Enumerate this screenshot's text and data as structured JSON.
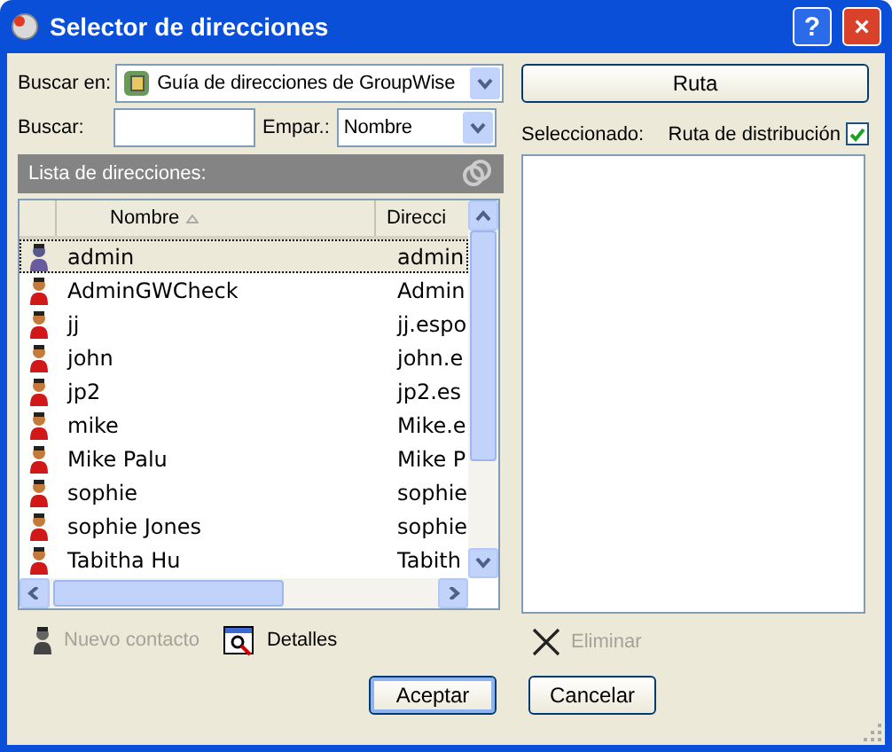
{
  "window": {
    "title": "Selector de direcciones",
    "help_button": "?",
    "close_button": "×"
  },
  "search_in": {
    "label": "Buscar en:",
    "value": "Guía de direcciones de GroupWise"
  },
  "search": {
    "label": "Buscar:"
  },
  "match": {
    "label": "Empar.:",
    "value": "Nombre"
  },
  "list": {
    "title": "Lista de direcciones:",
    "columns": [
      "Nombre",
      "Direcci"
    ],
    "rows": [
      {
        "name": "admin",
        "address": "admin",
        "selected": true
      },
      {
        "name": "AdminGWCheck",
        "address": "Admin",
        "selected": false
      },
      {
        "name": "jj",
        "address": "jj.espo",
        "selected": false
      },
      {
        "name": "john",
        "address": "john.e",
        "selected": false
      },
      {
        "name": "jp2",
        "address": "jp2.es",
        "selected": false
      },
      {
        "name": "mike",
        "address": "Mike.e",
        "selected": false
      },
      {
        "name": "Mike Palu",
        "address": "Mike P",
        "selected": false
      },
      {
        "name": "sophie",
        "address": "sophie",
        "selected": false
      },
      {
        "name": "sophie Jones",
        "address": "sophie",
        "selected": false
      },
      {
        "name": "Tabitha Hu",
        "address": "Tabith",
        "selected": false
      }
    ]
  },
  "left_actions": [
    {
      "label": "Nuevo contacto",
      "kind": "person",
      "disabled": true
    },
    {
      "label": "Detalles",
      "kind": "details",
      "disabled": false
    }
  ],
  "route_button": "Ruta",
  "selected_label": "Seleccionado:",
  "distribution_route": {
    "label": "Ruta de distribución",
    "checked": true
  },
  "remove_action": {
    "label": "Eliminar",
    "disabled": true
  },
  "buttons": [
    {
      "label": "Aceptar",
      "default": true
    },
    {
      "label": "Cancelar",
      "default": false
    }
  ]
}
